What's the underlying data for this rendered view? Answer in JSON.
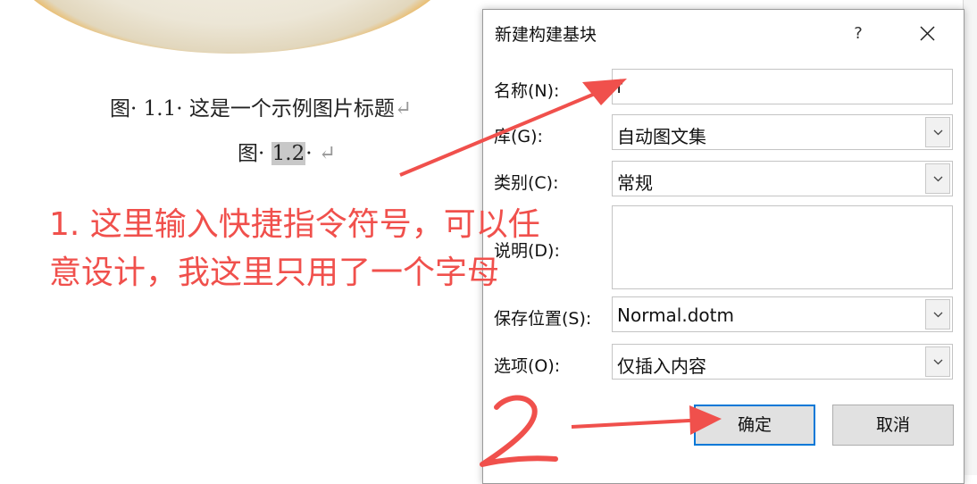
{
  "document": {
    "caption_1": "图· 1.1· 这是一个示例图片标题",
    "caption_2_prefix": "图·",
    "caption_2_number": "1.2",
    "caption_2_suffix": "·",
    "return_mark": "↵"
  },
  "dialog": {
    "title": "新建构建基块",
    "help_label": "?",
    "fields": {
      "name": {
        "label": "名称(N):",
        "value": "f"
      },
      "gallery": {
        "label": "库(G):",
        "value": "自动图文集"
      },
      "category": {
        "label": "类别(C):",
        "value": "常规"
      },
      "description": {
        "label": "说明(D):",
        "value": ""
      },
      "save_in": {
        "label": "保存位置(S):",
        "value": "Normal.dotm"
      },
      "options": {
        "label": "选项(O):",
        "value": "仅插入内容"
      }
    },
    "ok_label": "确定",
    "cancel_label": "取消"
  },
  "annotations": {
    "note_line_1": "1. 这里输入快捷指令符号，可以任",
    "note_line_2": "意设计，我这里只用了一个字母",
    "step_2": "2",
    "color": "#f0504c"
  },
  "colors": {
    "accent": "#0078d7",
    "annotation": "#f0504c"
  }
}
